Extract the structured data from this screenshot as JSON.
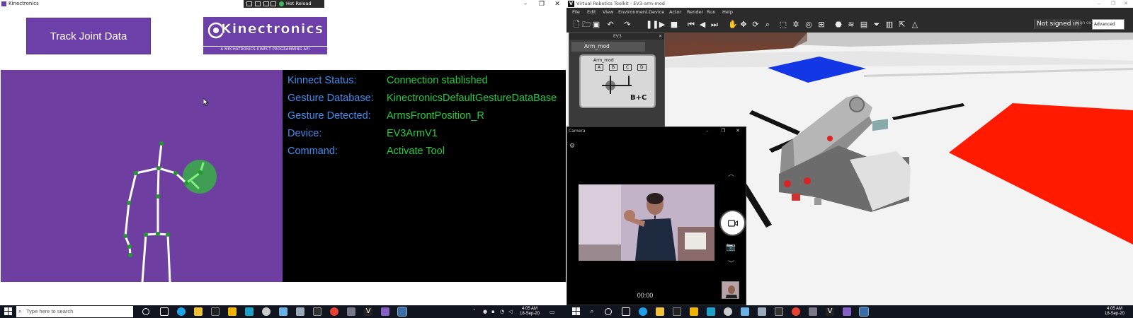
{
  "kinectronics": {
    "window_title": "Kinectronics",
    "hot_reload_label": "Hot Reload",
    "track_button_label": "Track Joint Data",
    "logo_text": "Kinectronics",
    "logo_subtitle": "A MECHATRONICS-KINECT PROGRAMMING API",
    "status": [
      {
        "label": "Kinnect Status:",
        "value": "Connection stablished"
      },
      {
        "label": "Gesture Database:",
        "value": "KinectronicsDefaultGestureDataBase"
      },
      {
        "label": "Gesture Detected:",
        "value": "ArmsFrontPosition_R"
      },
      {
        "label": "Device:",
        "value": "EV3ArmV1"
      },
      {
        "label": "Command:",
        "value": "Activate Tool"
      }
    ],
    "colors": {
      "panel": "#6e3fa1",
      "label": "#3d8ef0",
      "value": "#1fce3f"
    }
  },
  "vrt": {
    "window_title": "Virtual Robotics Toolkit - EV3-arm-mod",
    "menu": [
      "File",
      "Edit",
      "View",
      "Environment",
      "Device",
      "Actor",
      "Render",
      "Run",
      "Help"
    ],
    "signin_label": "Not signed in",
    "signout_label": "Sign out",
    "view_mode": "Advanced View",
    "ev3_panel_title": "EV3",
    "ev3_tab_label": "Arm_mod",
    "ev3_block_title": "Arm_mod",
    "ev3_ports": [
      "A",
      "B",
      "C",
      "D"
    ],
    "ev3_motor_label": "B+C"
  },
  "camera": {
    "window_title": "Camera",
    "timer": "00:00"
  },
  "taskbar_left": {
    "search_placeholder": "Type here to search",
    "time": "4:05 AM",
    "date": "18-Sep-20"
  },
  "taskbar_right": {
    "time": "4:05 AM",
    "date": "18-Sep-20"
  }
}
